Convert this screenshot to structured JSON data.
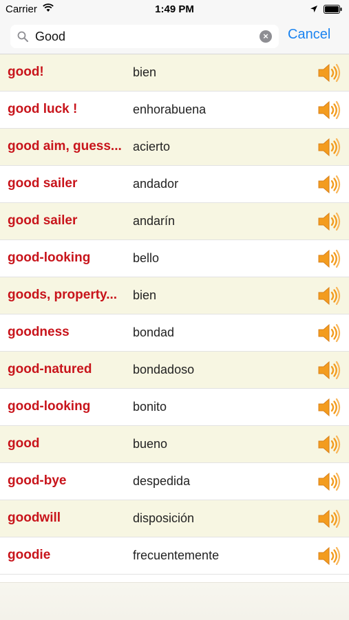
{
  "status_bar": {
    "carrier": "Carrier",
    "time": "1:49 PM"
  },
  "search": {
    "query": "Good",
    "cancel_label": "Cancel"
  },
  "icons": {
    "speaker": "speaker-icon",
    "search": "search-icon",
    "clear": "clear-icon"
  },
  "colors": {
    "word": "#c8141b",
    "accent": "#1a83f0",
    "alt_row": "#f7f6e2",
    "speaker": "#f39c1f"
  },
  "results": [
    {
      "word": "good!",
      "translation": "bien"
    },
    {
      "word": "good luck !",
      "translation": "enhorabuena"
    },
    {
      "word": "good aim, guess...",
      "translation": "acierto"
    },
    {
      "word": "good sailer",
      "translation": "andador"
    },
    {
      "word": "good sailer",
      "translation": "andarín"
    },
    {
      "word": "good-looking",
      "translation": "bello"
    },
    {
      "word": "goods, property...",
      "translation": "bien"
    },
    {
      "word": "goodness",
      "translation": "bondad"
    },
    {
      "word": "good-natured",
      "translation": "bondadoso"
    },
    {
      "word": "good-looking",
      "translation": "bonito"
    },
    {
      "word": "good",
      "translation": "bueno"
    },
    {
      "word": "good-bye",
      "translation": "despedida"
    },
    {
      "word": "goodwill",
      "translation": "disposición"
    },
    {
      "word": "goodie",
      "translation": "frecuentemente"
    }
  ]
}
